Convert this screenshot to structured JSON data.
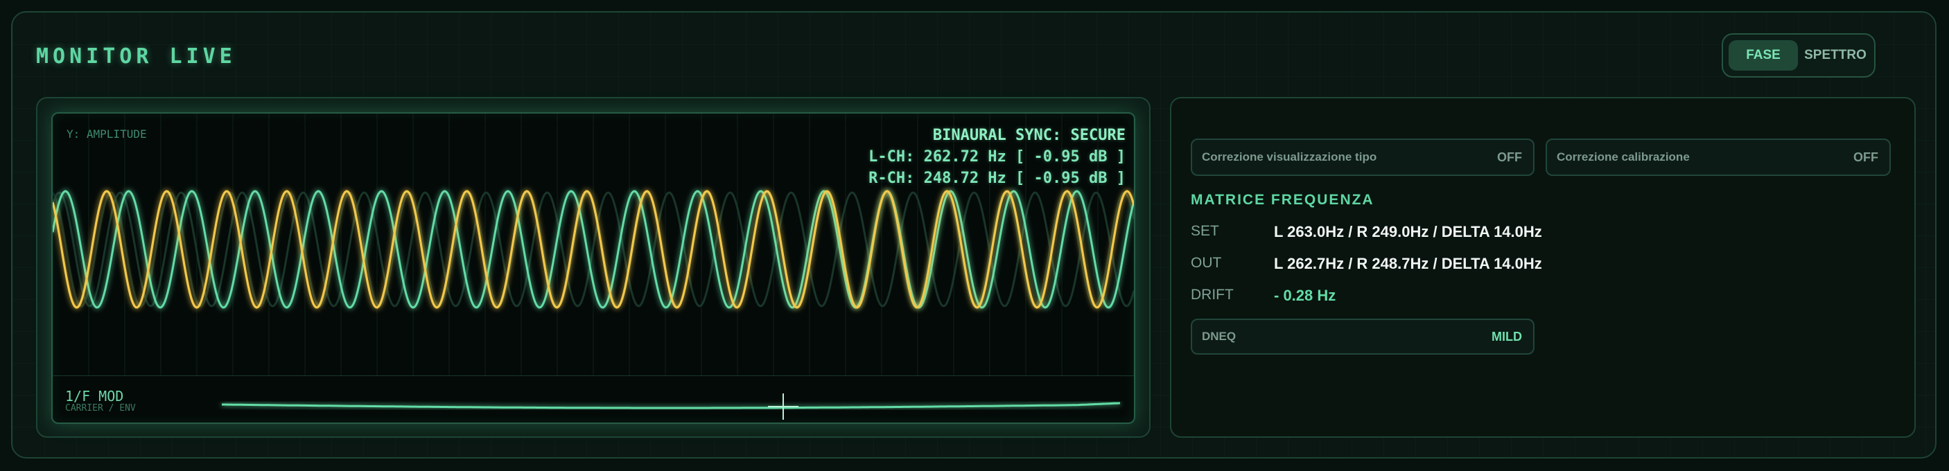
{
  "header": {
    "title": "MONITOR LIVE"
  },
  "view_toggle": {
    "options": [
      {
        "label": "FASE",
        "active": true
      },
      {
        "label": "SPETTRO",
        "active": false
      }
    ]
  },
  "scope": {
    "y_axis_label": "Y: AMPLITUDE",
    "sync_status": "BINAURAL SYNC: SECURE",
    "left_channel": "L-CH: 262.72 Hz [ -0.95 dB ]",
    "right_channel": "R-CH: 248.72 Hz [ -0.95 dB ]",
    "mod_label": "1/F MOD",
    "mod_sublabel": "CARRIER / ENV",
    "colors": {
      "left": "#f2c84b",
      "right": "#63dca6",
      "ghost": "#1c3a2e",
      "envelope": "#63dca6"
    }
  },
  "corrections": {
    "display_type": {
      "label": "Correzione visualizzazione tipo",
      "value": "OFF"
    },
    "calibration": {
      "label": "Correzione calibrazione",
      "value": "OFF"
    }
  },
  "matrix": {
    "title": "MATRICE FREQUENZA",
    "rows": [
      {
        "key": "SET",
        "value": "L 263.0Hz / R 249.0Hz / DELTA 14.0Hz"
      },
      {
        "key": "OUT",
        "value": "L 262.7Hz / R 248.7Hz / DELTA 14.0Hz"
      },
      {
        "key": "DRIFT",
        "value": "- 0.28 Hz"
      }
    ]
  },
  "dneq": {
    "label": "DNEQ",
    "value": "MILD"
  }
}
